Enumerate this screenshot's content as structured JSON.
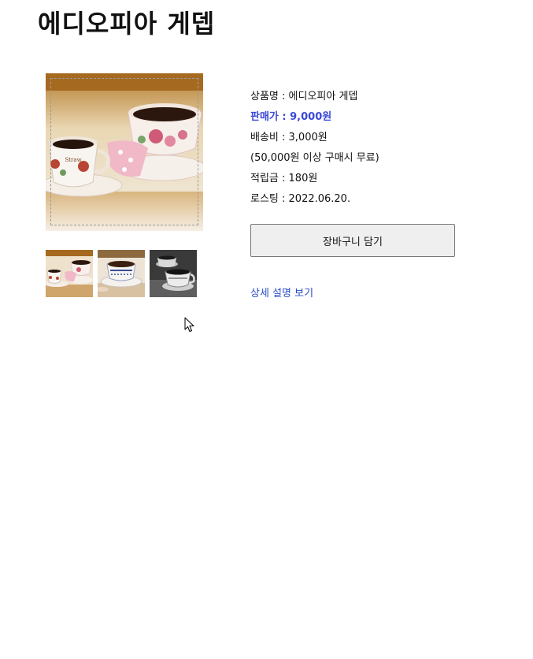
{
  "product": {
    "title": "에디오피아 게뎁",
    "name_row": "상품명 : 에디오피아 게뎁",
    "price_row": "판매가 : 9,000원",
    "shipping_row": "배송비 : 3,000원",
    "shipping_note": "(50,000원 이상 구매시 무료)",
    "points_row": "적립금 : 180원",
    "roasting_row": "로스팅 : 2022.06.20.",
    "cart_button": "장바구니 담기",
    "detail_link": "상세 설명 보기",
    "main_image_icon": "coffee-cups-photo",
    "thumbnails": [
      "coffee-cups-thumb-1",
      "coffee-cups-thumb-2",
      "coffee-cups-thumb-3"
    ]
  },
  "colors": {
    "price": "#3a49d6",
    "link": "#2b4ec6",
    "button_bg": "#efefef",
    "button_border": "#767676"
  }
}
